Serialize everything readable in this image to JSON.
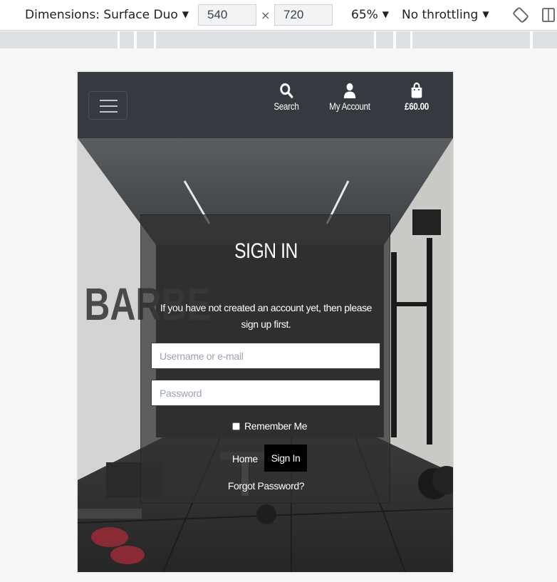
{
  "devtools": {
    "device_label": "Dimensions: Surface Duo",
    "width_value": "540",
    "times": "×",
    "height_value": "720",
    "zoom_label": "65%",
    "throttling_label": "No throttling"
  },
  "navbar": {
    "search_label": "Search",
    "account_label": "My Account",
    "bag_total": "£60.00"
  },
  "signin": {
    "title": "SIGN IN",
    "intro": "If you have not created an account yet, then please sign up first.",
    "username_placeholder": "Username or e-mail",
    "password_placeholder": "Password",
    "remember_label": "Remember Me",
    "home_label": "Home",
    "signin_button": "Sign In",
    "forgot_label": "Forgot Password?"
  },
  "background_wall_text": "BARBE"
}
